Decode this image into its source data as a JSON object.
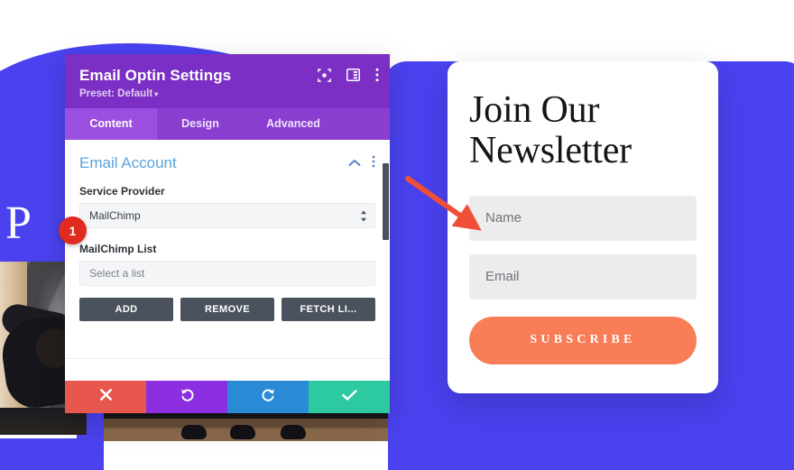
{
  "modal": {
    "title": "Email Optin Settings",
    "preset": "Preset: Default",
    "preset_caret": "▾",
    "header_icons": [
      {
        "name": "focus-target-icon"
      },
      {
        "name": "panel-layout-icon"
      },
      {
        "name": "more-vertical-icon"
      }
    ],
    "tabs": [
      {
        "label": "Content",
        "active": true
      },
      {
        "label": "Design",
        "active": false
      },
      {
        "label": "Advanced",
        "active": false
      }
    ],
    "section": {
      "title": "Email Account",
      "collapse_icon": "chevron-up-icon",
      "menu_icon": "more-vertical-icon"
    },
    "fields": {
      "service_provider_label": "Service Provider",
      "service_provider_value": "MailChimp",
      "list_label": "MailChimp List",
      "list_placeholder": "Select a list"
    },
    "buttons": {
      "add": "ADD",
      "remove": "REMOVE",
      "fetch": "FETCH LI..."
    },
    "actions": [
      {
        "label": "cancel",
        "icon": "close-icon",
        "color": "#e8574e"
      },
      {
        "label": "undo",
        "icon": "undo-icon",
        "color": "#8b2fe0"
      },
      {
        "label": "redo",
        "icon": "redo-icon",
        "color": "#2b8ad6"
      },
      {
        "label": "save",
        "icon": "check-icon",
        "color": "#2dc9a0"
      }
    ]
  },
  "badge": {
    "number": "1"
  },
  "hero": {
    "partial_text": "d P"
  },
  "newsletter": {
    "title": "Join Our Newsletter",
    "name_placeholder": "Name",
    "name_value": "",
    "email_placeholder": "Email",
    "email_value": "",
    "subscribe_label": "SUBSCRIBE"
  },
  "colors": {
    "background_blue": "#4a42ef",
    "modal_header_purple": "#7b2fc4",
    "tab_bar_purple": "#8a3fd1",
    "tab_active_purple": "#9a4fe0",
    "section_title_blue": "#5aa3dc",
    "flat_button_slate": "#4a525e",
    "badge_red": "#e02b20",
    "arrow_red": "#ef4f36",
    "subscribe_orange": "#f97d57"
  }
}
